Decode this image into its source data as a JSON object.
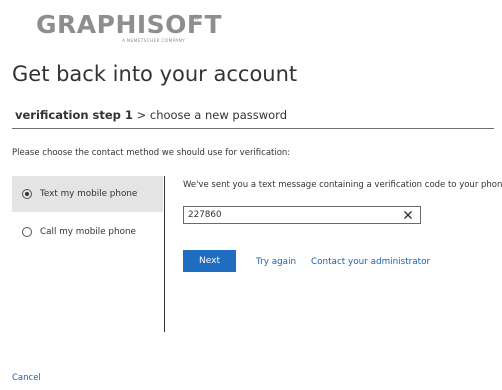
{
  "logo": {
    "brand": "GRAPHISOFT",
    "trademark": "®",
    "tagline": "A NEMETSCHEK COMPANY"
  },
  "page": {
    "title": "Get back into your account"
  },
  "steps": {
    "current": "verification step 1",
    "separator": " > ",
    "next": "choose a new password"
  },
  "instruction": "Please choose the contact method we should use for verification:",
  "methods": [
    {
      "label": "Text my mobile phone",
      "selected": true
    },
    {
      "label": "Call my mobile phone",
      "selected": false
    }
  ],
  "verification": {
    "message": "We've sent you a text message containing a verification code to your phone.",
    "code_value": "227860"
  },
  "actions": {
    "next_label": "Next",
    "try_again_label": "Try again",
    "contact_admin_label": "Contact your administrator",
    "cancel_label": "Cancel"
  },
  "colors": {
    "accent": "#1e6dc1",
    "link": "#1a62b0",
    "selected_bg": "#e4e4e4",
    "logo_gray": "#8e8e8e"
  }
}
